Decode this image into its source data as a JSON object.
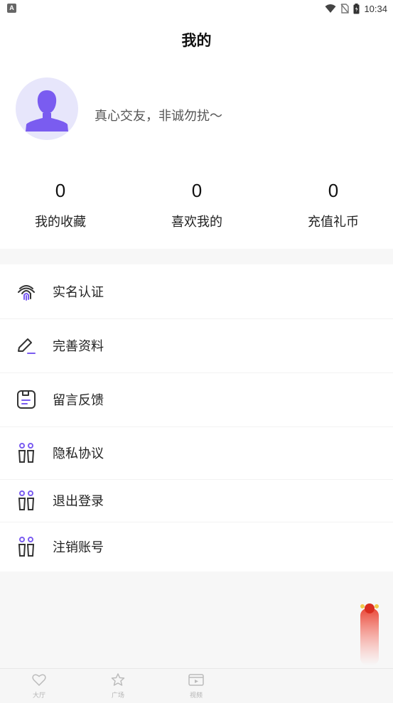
{
  "status_bar": {
    "left_badge": "A",
    "time": "10:34"
  },
  "header": {
    "title": "我的"
  },
  "profile": {
    "motto": "真心交友，非诚勿扰～"
  },
  "stats": [
    {
      "value": "0",
      "label": "我的收藏"
    },
    {
      "value": "0",
      "label": "喜欢我的"
    },
    {
      "value": "0",
      "label": "充值礼币"
    }
  ],
  "menu": [
    {
      "label": "实名认证",
      "icon": "fingerprint-icon"
    },
    {
      "label": "完善资料",
      "icon": "edit-icon"
    },
    {
      "label": "留言反馈",
      "icon": "feedback-icon"
    },
    {
      "label": "隐私协议",
      "icon": "privacy-icon"
    },
    {
      "label": "退出登录",
      "icon": "logout-icon"
    },
    {
      "label": "注销账号",
      "icon": "delete-account-icon"
    }
  ],
  "tabbar": [
    {
      "label": "大厅",
      "icon": "heart-icon"
    },
    {
      "label": "广场",
      "icon": "star-icon"
    },
    {
      "label": "视频",
      "icon": "video-icon"
    }
  ],
  "colors": {
    "accent": "#7a5cf0",
    "avatar_bg": "#e7e6fb",
    "icon_stroke": "#333333"
  }
}
